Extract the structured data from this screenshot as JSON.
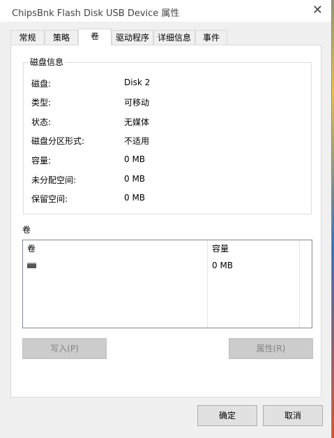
{
  "window": {
    "title": "ChipsBnk Flash Disk USB Device 属性",
    "close_glyph": "✕"
  },
  "tabs": [
    {
      "label": "常规"
    },
    {
      "label": "策略"
    },
    {
      "label": "卷",
      "active": true
    },
    {
      "label": "驱动程序"
    },
    {
      "label": "详细信息"
    },
    {
      "label": "事件"
    }
  ],
  "disk_info": {
    "group_title": "磁盘信息",
    "rows": [
      {
        "key": "磁盘:",
        "value": "Disk 2"
      },
      {
        "key": "类型:",
        "value": "可移动"
      },
      {
        "key": "状态:",
        "value": "无媒体"
      },
      {
        "key": "磁盘分区形式:",
        "value": "不适用"
      },
      {
        "key": "容量:",
        "value": "0 MB"
      },
      {
        "key": "未分配空间:",
        "value": "0 MB"
      },
      {
        "key": "保留空间:",
        "value": "0 MB"
      }
    ]
  },
  "volumes": {
    "section_label": "卷",
    "columns": [
      "卷",
      "容量"
    ],
    "rows": [
      {
        "volume": "",
        "capacity": "0 MB",
        "icon": "drive-icon"
      }
    ]
  },
  "buttons": {
    "write": "写入(P)",
    "properties": "属性(R)",
    "ok": "确定",
    "cancel": "取消"
  }
}
